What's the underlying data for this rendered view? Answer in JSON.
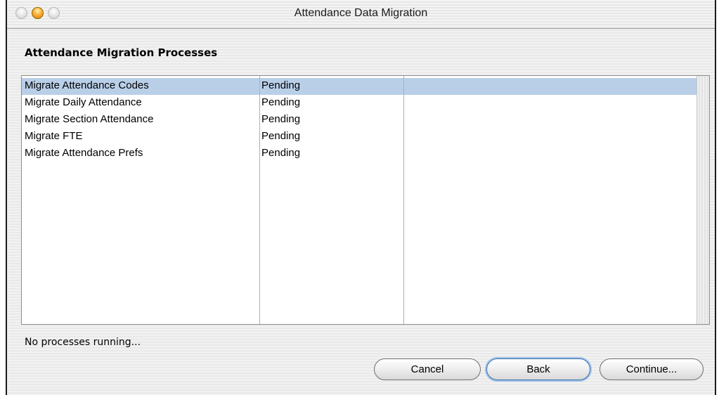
{
  "window": {
    "title": "Attendance Data Migration"
  },
  "section": {
    "title": "Attendance Migration Processes"
  },
  "processes": [
    {
      "name": "Migrate Attendance Codes",
      "status": "Pending",
      "selected": true
    },
    {
      "name": "Migrate Daily Attendance",
      "status": "Pending",
      "selected": false
    },
    {
      "name": "Migrate Section Attendance",
      "status": "Pending",
      "selected": false
    },
    {
      "name": "Migrate FTE",
      "status": "Pending",
      "selected": false
    },
    {
      "name": "Migrate Attendance Prefs",
      "status": "Pending",
      "selected": false
    }
  ],
  "status": {
    "text": "No processes running..."
  },
  "buttons": {
    "cancel": "Cancel",
    "back": "Back",
    "continue": "Continue..."
  },
  "colors": {
    "selection": "#b9cfe8",
    "focus_ring": "#9ec3ea",
    "minimize_button": "#f7b23a"
  }
}
